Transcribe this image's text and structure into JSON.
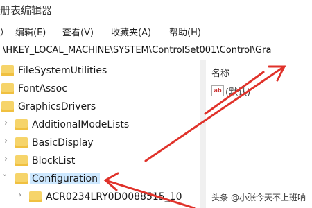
{
  "window": {
    "title": "册表编辑器"
  },
  "menu": {
    "items": [
      "）",
      "编辑(E)",
      "查看(V)",
      "收藏夹(A)",
      "帮助(H)"
    ]
  },
  "address": {
    "path": "\\HKEY_LOCAL_MACHINE\\SYSTEM\\ControlSet001\\Control\\Gra"
  },
  "tree": {
    "items": [
      {
        "label": "FileSystemUtilities"
      },
      {
        "label": "FontAssoc"
      },
      {
        "label": "GraphicsDrivers"
      },
      {
        "label": "AdditionalModeLists"
      },
      {
        "label": "BasicDisplay"
      },
      {
        "label": "BlockList"
      },
      {
        "label": "Configuration"
      },
      {
        "label": "ACR0234LRY0D0088515_10"
      }
    ]
  },
  "values_pane": {
    "column_name": "名称",
    "default_value": "(默认)"
  },
  "watermark": "头条 @小张今天不上班呐",
  "colors": {
    "annotation_arrow": "#e0322a",
    "folder": "#f6d46a",
    "selection": "#cde8ff"
  }
}
